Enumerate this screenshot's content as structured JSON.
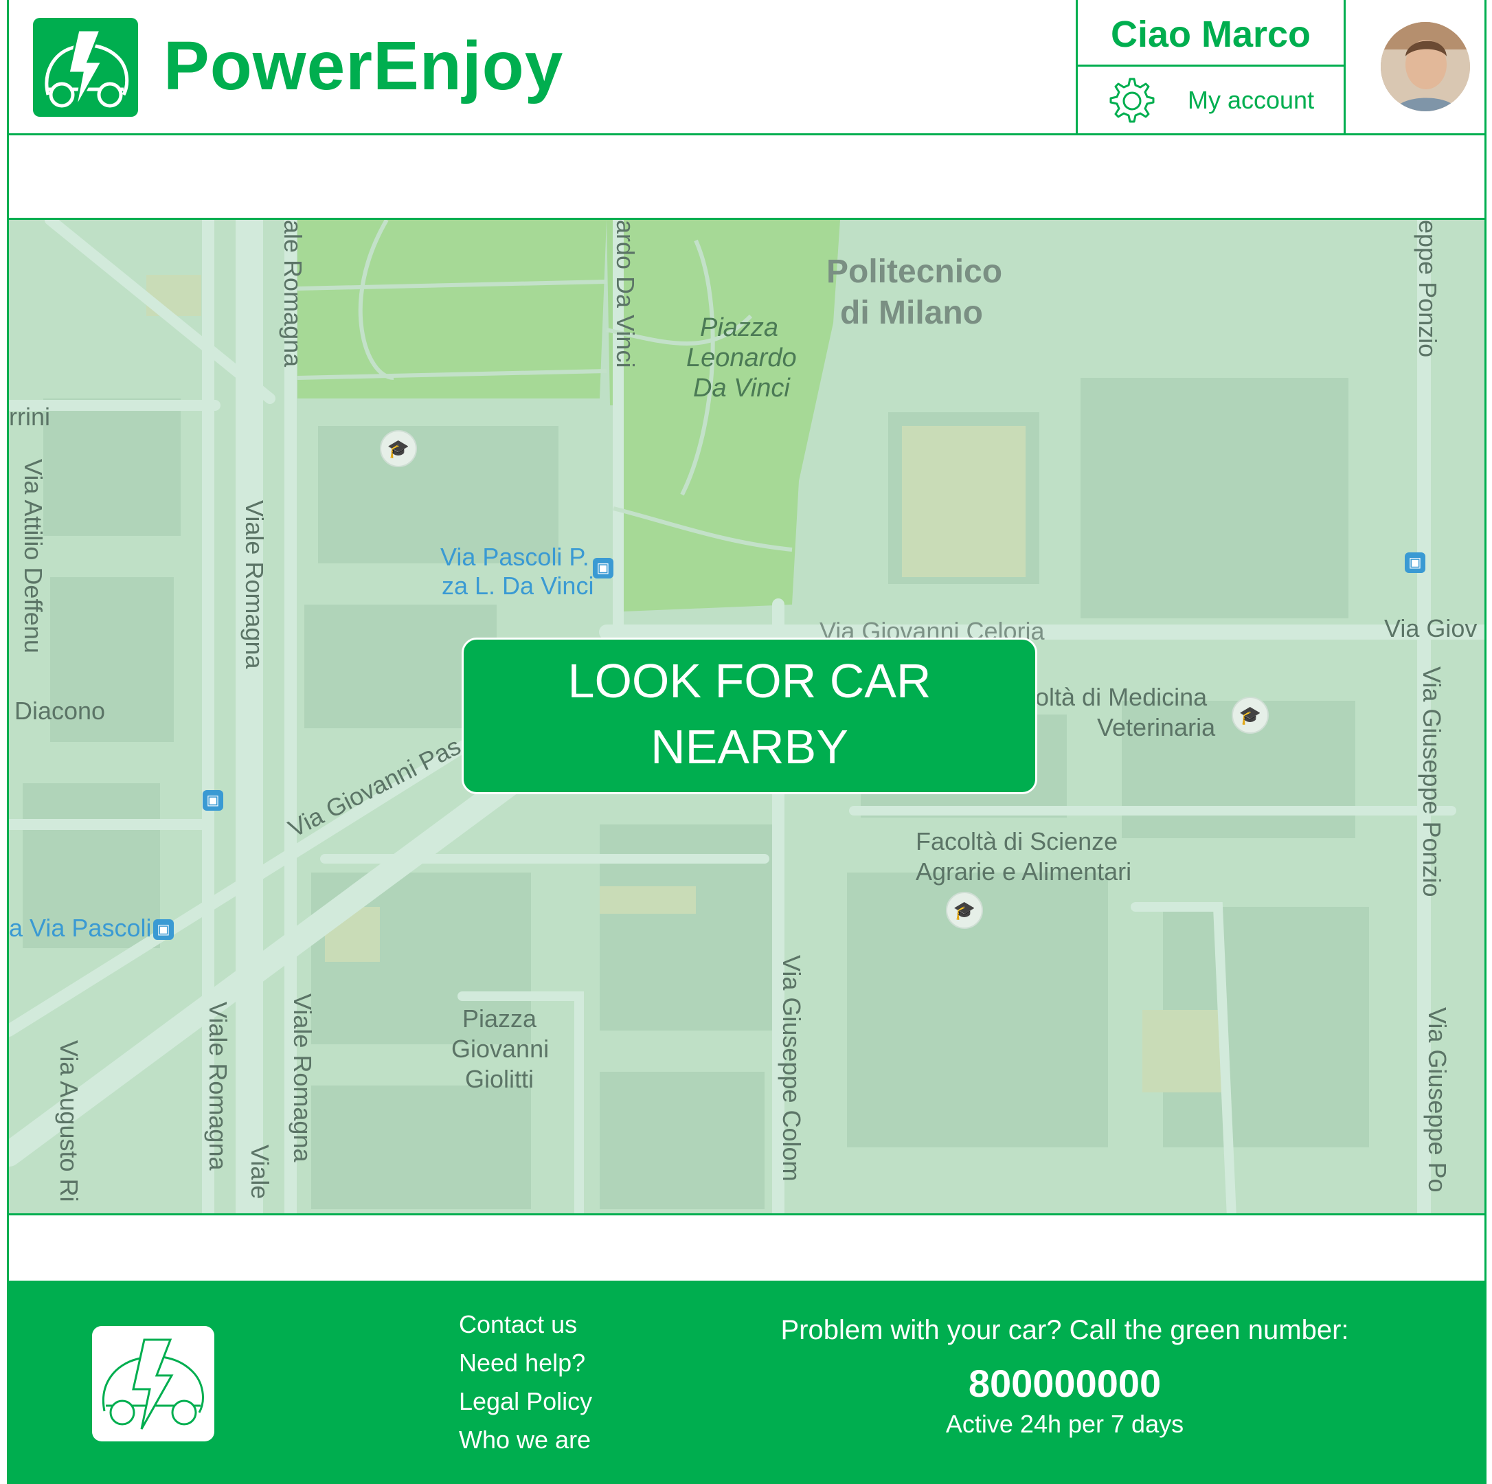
{
  "header": {
    "brand": "PowerEnjoy",
    "greeting": "Ciao Marco",
    "account_label": "My account",
    "logo_icon": "electric-car-icon",
    "settings_icon": "gear-icon",
    "accent_color": "#00ae4f"
  },
  "map": {
    "labels": {
      "politecnico_1": "Politecnico",
      "politecnico_2": "di Milano",
      "piazza_ldv_1": "Piazza",
      "piazza_ldv_2": "Leonardo",
      "piazza_ldv_3": "Da Vinci",
      "leonardo_road": "ardo Da Vinci",
      "viale_romagna_top": "ale Romagna",
      "viale_romagna_1": "Viale Romagna",
      "viale_romagna_2": "Viale Romagna",
      "viale_romagna_3": "Viale Romagna",
      "viale_short": "Viale",
      "via_attilio": "Via Attilio Deffenu",
      "rrini": "rrini",
      "diacono": "Diacono",
      "via_pascoli_p1": "Via Pascoli P.",
      "via_pascoli_p2": "za L. Da Vinci",
      "via_giovanni_pas": "Via Giovanni Pas",
      "via_celoria": "Via Giovanni Celoria",
      "via_giov": "Via Giov",
      "medicina_1": "oltà di Medicina",
      "medicina_2": "Veterinaria",
      "agrarie_1": "Facoltà di Scienze",
      "agrarie_2": "Agrarie e Alimentari",
      "via_pascoli_left": "a Via Pascoli",
      "piazza_giolitti_1": "Piazza",
      "piazza_giolitti_2": "Giovanni",
      "piazza_giolitti_3": "Giolitti",
      "via_colom": "Via Giuseppe Colom",
      "ponzio_top": "eppe Ponzio",
      "ponzio_mid": "Via Giuseppe Ponzio",
      "ponzio_bot": "Via Giuseppe Po",
      "via_augusto": "Via Augusto Ri"
    }
  },
  "cta": {
    "line1": "LOOK FOR CAR",
    "line2": "NEARBY"
  },
  "footer": {
    "links": [
      "Contact us",
      "Need help?",
      "Legal Policy",
      "Who we are"
    ],
    "help_question": "Problem with your car? Call the green number:",
    "phone": "800000000",
    "availability": "Active 24h per 7 days"
  }
}
